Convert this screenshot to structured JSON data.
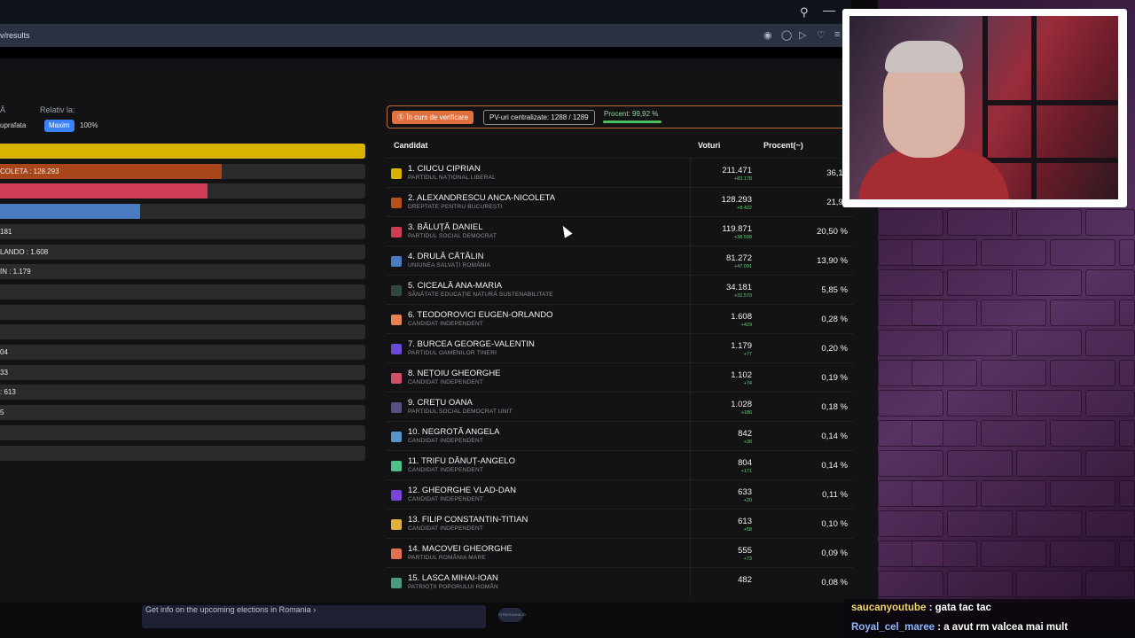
{
  "browser": {
    "url_fragment": "v/results",
    "toolbar_icons": [
      "camera-icon",
      "shield-icon",
      "play-icon",
      "heart-icon",
      "menu-icon"
    ]
  },
  "left_panel": {
    "relativ_label": "Relativ la:",
    "corner_text": "Ă",
    "suprafata": "uprafata",
    "maxim_btn": "Maxim",
    "pct_btn": "100%"
  },
  "bars": [
    {
      "label": "",
      "fraction": 1.0,
      "color": "#d9b300"
    },
    {
      "label": "COLETA : 128.293",
      "fraction": 0.607,
      "color": "#a8461a"
    },
    {
      "label": "",
      "fraction": 0.567,
      "color": "#cf3d55"
    },
    {
      "label": "",
      "fraction": 0.384,
      "color": "#4a7bc0"
    },
    {
      "label": "181",
      "fraction": 0,
      "color": "#3a4b3e"
    },
    {
      "label": "LANDO : 1.608",
      "fraction": 0,
      "color": "#e88050"
    },
    {
      "label": "IN : 1.179",
      "fraction": 0,
      "color": "#7a55e0"
    },
    {
      "label": "",
      "fraction": 0,
      "color": "#d0506a"
    },
    {
      "label": "",
      "fraction": 0,
      "color": "#5a4d80"
    },
    {
      "label": "",
      "fraction": 0,
      "color": "#5a94c8"
    },
    {
      "label": "04",
      "fraction": 0,
      "color": "#4fc08a"
    },
    {
      "label": "33",
      "fraction": 0,
      "color": "#7a45d8"
    },
    {
      "label": ": 613",
      "fraction": 0,
      "color": "#e0b040"
    },
    {
      "label": "5",
      "fraction": 0,
      "color": "#e07050"
    },
    {
      "label": "",
      "fraction": 0,
      "color": "#4a9a80"
    },
    {
      "label": "",
      "fraction": 0,
      "color": "#444"
    }
  ],
  "status": {
    "badge": "Ⓢ În curs de verificare",
    "pv": "PV-uri centralizate: 1288 / 1289",
    "procent": "Procent: 99,92 %",
    "procent_fraction": 0.9992
  },
  "table": {
    "headers": {
      "candidat": "Candidat",
      "voturi": "Voturi",
      "procent": "Procent(~)"
    },
    "rows": [
      {
        "name": "1. CIUCU CIPRIAN",
        "party": "PARTIDUL NAȚIONAL LIBERAL",
        "votes": "211.471",
        "delta": "+83.178",
        "pct": "36,17",
        "color": "#d9b300"
      },
      {
        "name": "2. ALEXANDRESCU ANCA-NICOLETA",
        "party": "DREPTATE PENTRU BUCUREȘTI",
        "votes": "128.293",
        "delta": "+8.422",
        "pct": "21,94",
        "color": "#b8501e"
      },
      {
        "name": "3. BĂLUȚĂ DANIEL",
        "party": "PARTIDUL SOCIAL DEMOCRAT",
        "votes": "119.871",
        "delta": "+38.599",
        "pct": "20,50 %",
        "color": "#cf3d55"
      },
      {
        "name": "4. DRULĂ CĂTĂLIN",
        "party": "UNIUNEA SALVAȚI ROMÂNIA",
        "votes": "81.272",
        "delta": "+47.091",
        "pct": "13,90 %",
        "color": "#4a7bc0"
      },
      {
        "name": "5. CICEALĂ ANA-MARIA",
        "party": "SĂNĂTATE EDUCAȚIE NATURĂ SUSTENABILITATE",
        "votes": "34.181",
        "delta": "+32.573",
        "pct": "5,85 %",
        "color": "#2f4a3a"
      },
      {
        "name": "6. TEODOROVICI EUGEN-ORLANDO",
        "party": "CANDIDAT INDEPENDENT",
        "votes": "1.608",
        "delta": "+429",
        "pct": "0,28 %",
        "color": "#e88050"
      },
      {
        "name": "7. BURCEA GEORGE-VALENTIN",
        "party": "PARTIDUL OAMENILOR TINERI",
        "votes": "1.179",
        "delta": "+77",
        "pct": "0,20 %",
        "color": "#6a4ad8"
      },
      {
        "name": "8. NEȚOIU GHEORGHE",
        "party": "CANDIDAT INDEPENDENT",
        "votes": "1.102",
        "delta": "+74",
        "pct": "0,19 %",
        "color": "#d0506a"
      },
      {
        "name": "9. CREȚU OANA",
        "party": "PARTIDUL SOCIAL DEMOCRAT UNIT",
        "votes": "1.028",
        "delta": "+186",
        "pct": "0,18 %",
        "color": "#5a4d80"
      },
      {
        "name": "10. NEGROTĂ ANGELA",
        "party": "CANDIDAT INDEPENDENT",
        "votes": "842",
        "delta": "+38",
        "pct": "0,14 %",
        "color": "#5a94c8"
      },
      {
        "name": "11. TRIFU DĂNUȚ-ANGELO",
        "party": "CANDIDAT INDEPENDENT",
        "votes": "804",
        "delta": "+171",
        "pct": "0,14 %",
        "color": "#4fc08a"
      },
      {
        "name": "12. GHEORGHE VLAD-DAN",
        "party": "CANDIDAT INDEPENDENT",
        "votes": "633",
        "delta": "+20",
        "pct": "0,11 %",
        "color": "#7a45d8"
      },
      {
        "name": "13. FILIP CONSTANTIN-TITIAN",
        "party": "CANDIDAT INDEPENDENT",
        "votes": "613",
        "delta": "+58",
        "pct": "0,10 %",
        "color": "#e0b040"
      },
      {
        "name": "14. MACOVEI GHEORGHE",
        "party": "PARTIDUL ROMÂNIA MARE",
        "votes": "555",
        "delta": "+73",
        "pct": "0,09 %",
        "color": "#e07050"
      },
      {
        "name": "15. LASCA MIHAI-IOAN",
        "party": "PATRIOȚII POPORULUI ROMÂN",
        "votes": "482",
        "delta": "",
        "pct": "0,08 %",
        "color": "#4a9a80"
      }
    ]
  },
  "bottom": {
    "ad_text": "Get info on the upcoming elections in Romania  ›",
    "logo_text": "STRIKEDANA.ID"
  },
  "chat": [
    {
      "user": "saucanyoutube",
      "msg": ": gata tac tac"
    },
    {
      "user": "Royal_cel_maree",
      "msg": ": a avut rm valcea mai mult"
    }
  ]
}
